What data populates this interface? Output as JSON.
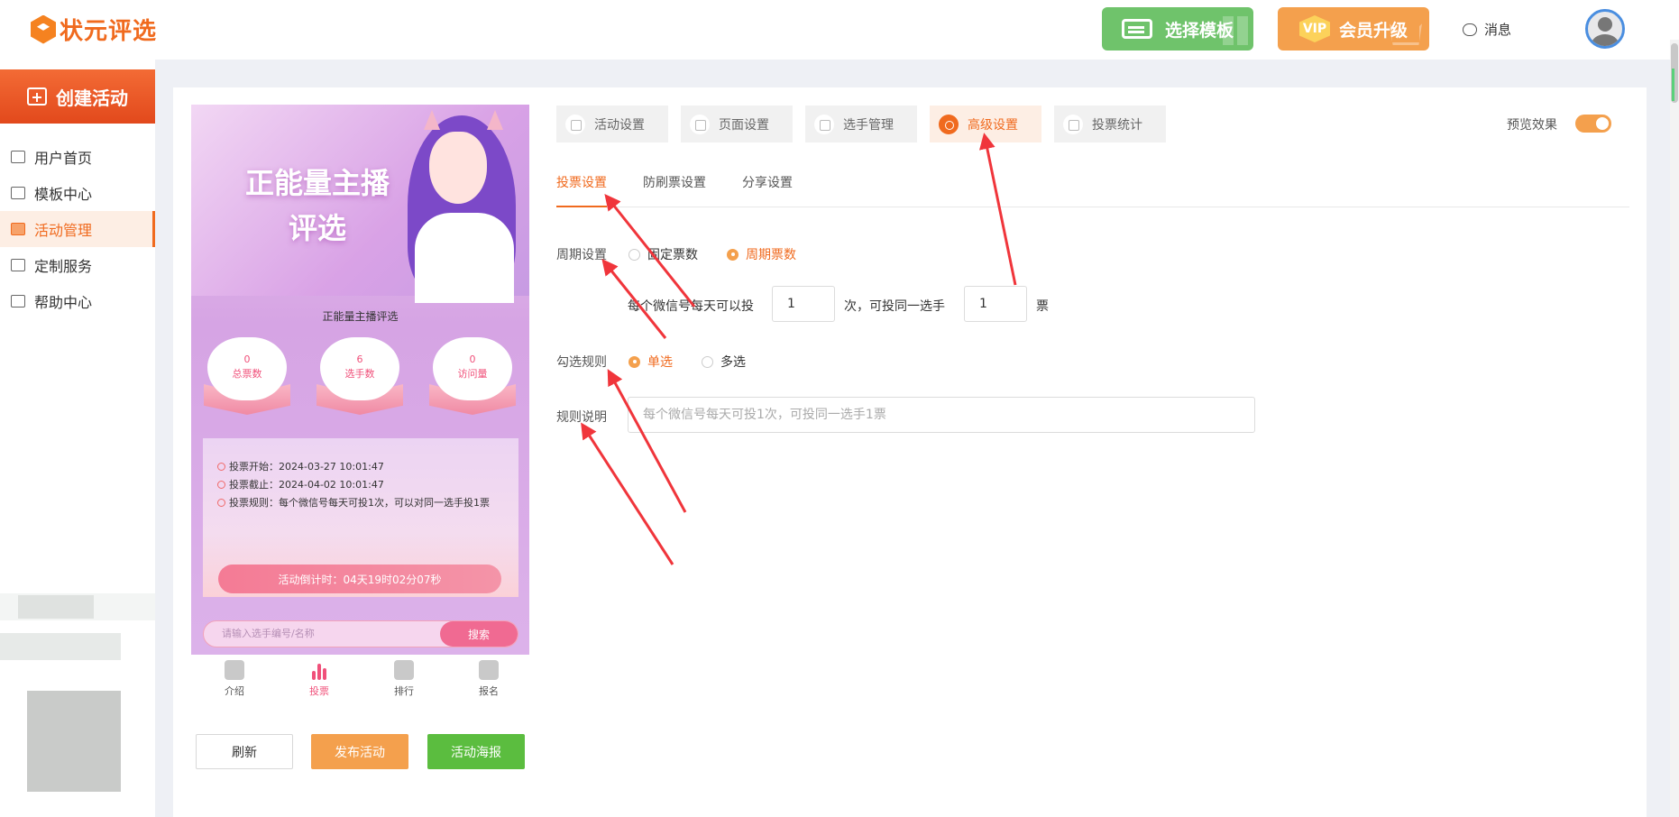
{
  "header": {
    "logo_text": "状元评选",
    "template_button": "选择模板",
    "vip_badge": "VIP",
    "vip_button": "会员升级",
    "messages": "消息"
  },
  "sidebar": {
    "create_button": "创建活动",
    "items": [
      {
        "label": "用户首页",
        "icon": "home-icon"
      },
      {
        "label": "模板中心",
        "icon": "folder-icon"
      },
      {
        "label": "活动管理",
        "icon": "ticket-icon"
      },
      {
        "label": "定制服务",
        "icon": "tools-icon"
      },
      {
        "label": "帮助中心",
        "icon": "box-icon"
      }
    ]
  },
  "preview": {
    "banner_title_1": "正能量主播",
    "banner_title_2": "评选",
    "subtitle": "正能量主播评选",
    "stats": [
      {
        "value": "0",
        "label": "总票数"
      },
      {
        "value": "6",
        "label": "选手数"
      },
      {
        "value": "0",
        "label": "访问量"
      }
    ],
    "info": {
      "start": "投票开始：2024-03-27 10:01:47",
      "end": "投票截止：2024-04-02 10:01:47",
      "rule": "投票规则：每个微信号每天可投1次，可以对同一选手投1票"
    },
    "countdown": "活动倒计时：04天19时02分07秒",
    "search_placeholder": "请输入选手编号/名称",
    "search_button": "搜索",
    "tabs": [
      "介绍",
      "投票",
      "排行",
      "报名"
    ]
  },
  "actions": {
    "refresh": "刷新",
    "publish": "发布活动",
    "poster": "活动海报"
  },
  "settings": {
    "tabs": [
      "活动设置",
      "页面设置",
      "选手管理",
      "高级设置",
      "投票统计"
    ],
    "active_tab": "高级设置",
    "preview_label": "预览效果",
    "preview_enabled": true,
    "subtabs": [
      "投票设置",
      "防刷票设置",
      "分享设置"
    ],
    "active_subtab": "投票设置",
    "cycle_label": "周期设置",
    "cycle_options": [
      "固定票数",
      "周期票数"
    ],
    "cycle_selected": "周期票数",
    "per_day_prefix": "每个微信号每天可以投",
    "per_day_value": "1",
    "per_day_mid": "次，可投同一选手",
    "per_player_value": "1",
    "per_player_suffix": "票",
    "select_label": "勾选规则",
    "select_options": [
      "单选",
      "多选"
    ],
    "select_selected": "单选",
    "rule_label": "规则说明",
    "rule_placeholder": "每个微信号每天可投1次，可投同一选手1票"
  },
  "colors": {
    "accent": "#f06a1e",
    "annotation_arrow": "#f0353b",
    "green": "#5bbd3f"
  }
}
